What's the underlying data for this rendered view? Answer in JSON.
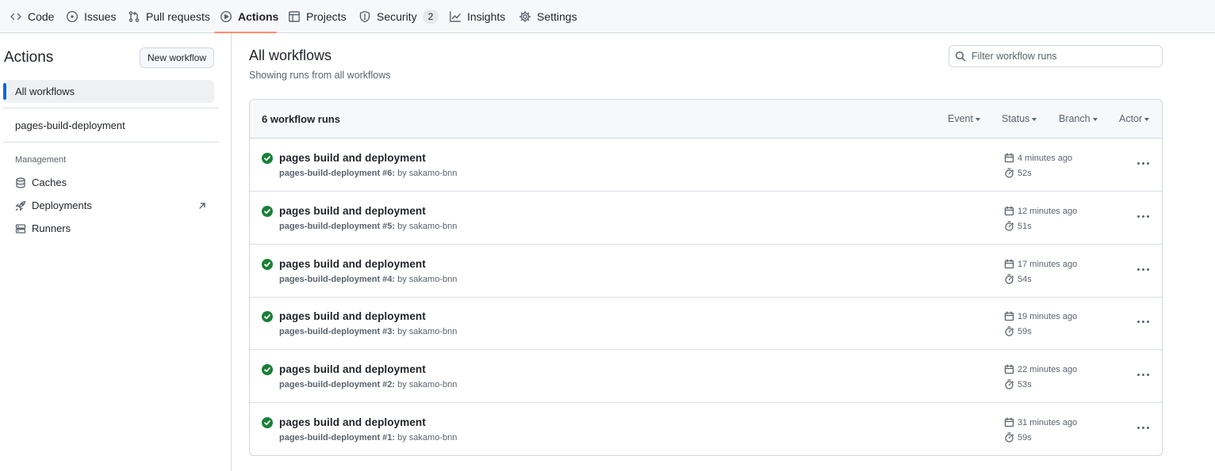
{
  "nav": {
    "items": [
      {
        "label": "Code",
        "icon": "code-icon"
      },
      {
        "label": "Issues",
        "icon": "issue-icon"
      },
      {
        "label": "Pull requests",
        "icon": "pull-request-icon"
      },
      {
        "label": "Actions",
        "icon": "play-icon",
        "selected": true
      },
      {
        "label": "Projects",
        "icon": "table-icon"
      },
      {
        "label": "Security",
        "icon": "shield-icon",
        "count": "2"
      },
      {
        "label": "Insights",
        "icon": "graph-icon"
      },
      {
        "label": "Settings",
        "icon": "gear-icon"
      }
    ],
    "selected_color": "#fd8c73"
  },
  "sidebar": {
    "title": "Actions",
    "new_workflow": "New workflow",
    "all_workflows": "All workflows",
    "workflow": "pages-build-deployment",
    "management_heading": "Management",
    "management": [
      {
        "label": "Caches",
        "icon": "database-icon"
      },
      {
        "label": "Deployments",
        "icon": "rocket-icon",
        "external": true
      },
      {
        "label": "Runners",
        "icon": "server-icon"
      }
    ]
  },
  "main": {
    "title": "All workflows",
    "subtitle": "Showing runs from all workflows",
    "filter_placeholder": "Filter workflow runs",
    "runs_count": "6 workflow runs",
    "filters": [
      "Event",
      "Status",
      "Branch",
      "Actor"
    ],
    "runs": [
      {
        "title": "pages build and deployment",
        "workflow": "pages-build-deployment #6:",
        "by": " by sakamo-bnn",
        "time": "4 minutes ago",
        "duration": "52s",
        "status": "success"
      },
      {
        "title": "pages build and deployment",
        "workflow": "pages-build-deployment #5:",
        "by": " by sakamo-bnn",
        "time": "12 minutes ago",
        "duration": "51s",
        "status": "success"
      },
      {
        "title": "pages build and deployment",
        "workflow": "pages-build-deployment #4:",
        "by": " by sakamo-bnn",
        "time": "17 minutes ago",
        "duration": "54s",
        "status": "success"
      },
      {
        "title": "pages build and deployment",
        "workflow": "pages-build-deployment #3:",
        "by": " by sakamo-bnn",
        "time": "19 minutes ago",
        "duration": "59s",
        "status": "success"
      },
      {
        "title": "pages build and deployment",
        "workflow": "pages-build-deployment #2:",
        "by": " by sakamo-bnn",
        "time": "22 minutes ago",
        "duration": "53s",
        "status": "success"
      },
      {
        "title": "pages build and deployment",
        "workflow": "pages-build-deployment #1:",
        "by": " by sakamo-bnn",
        "time": "31 minutes ago",
        "duration": "59s",
        "status": "success"
      }
    ],
    "success_color": "#1a7f37"
  }
}
